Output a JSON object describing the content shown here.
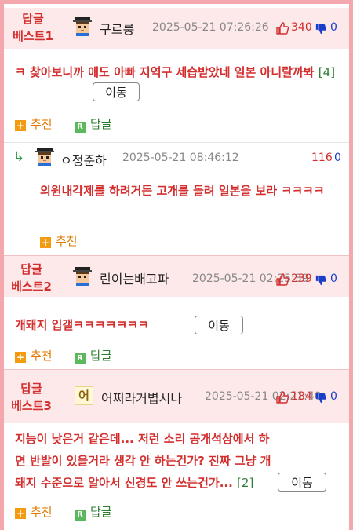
{
  "actions": {
    "recommend_label": "추천",
    "reply_label": "답글",
    "move_label": "이동"
  },
  "best": [
    {
      "rank_line1": "답글",
      "rank_line2": "베스트1",
      "nickname": "구르룽",
      "date": "2025-05-21 07:26:26",
      "up": "340",
      "down": "0",
      "content": "ㅋ 찾아보니까 애도 아빠 지역구 세습받았네 일본 아니랄까봐",
      "reply_count": "[4]"
    },
    {
      "rank_line1": "답글",
      "rank_line2": "베스트2",
      "nickname": "린이는배고파",
      "date": "2025-05-21 02:25:39",
      "up": "239",
      "down": "0",
      "content": "개돼지 입갤ㅋㅋㅋㅋㅋㅋㅋ",
      "reply_count": ""
    },
    {
      "rank_line1": "답글",
      "rank_line2": "베스트3",
      "nickname": "어쩌라거볍시나",
      "avatar_text": "어",
      "date": "2025-05-21 02:21:40",
      "up": "184",
      "down": "0",
      "content": "지능이 낮은거 같은데... 저런 소리 공개석상에서 하면 반발이 있을거라 생각 안 하는건가? 진짜 그냥 개돼지 수준으로 알아서 신경도 안 쓰는건가...",
      "reply_count": "[2]"
    }
  ],
  "reply": {
    "arrow": "↳",
    "nickname": "ㅇ정준하",
    "date": "2025-05-21 08:46:12",
    "up": "116",
    "down": "0",
    "content": "의원내각제를 하려거든 고개를 돌려 일본을 보라 ㅋㅋㅋㅋ"
  }
}
